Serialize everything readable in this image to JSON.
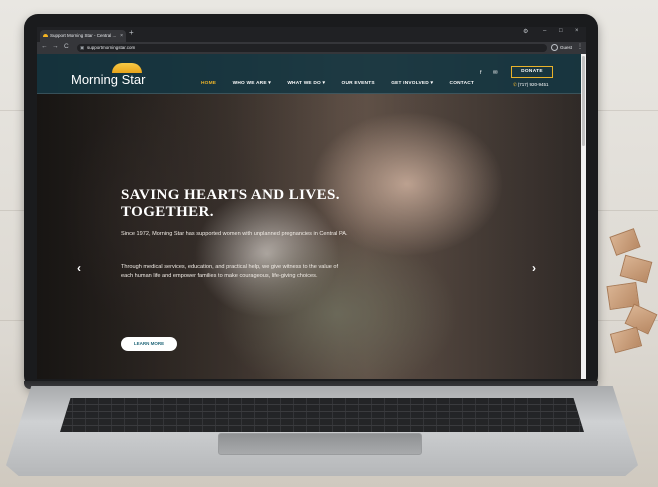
{
  "browser": {
    "tab_title": "Support Morning Star - Central ...",
    "tab_close": "×",
    "new_tab": "+",
    "url": "supportmorningstar.com",
    "profile": "Guest",
    "win_minimize": "–",
    "win_maximize": "□",
    "win_close": "×",
    "back": "←",
    "forward": "→",
    "reload": "C",
    "menu": "⋮"
  },
  "site": {
    "logo_text": "Morning Star",
    "nav": [
      {
        "label": "HOME"
      },
      {
        "label": "WHO WE ARE ▾"
      },
      {
        "label": "WHAT WE DO ▾"
      },
      {
        "label": "OUR EVENTS"
      },
      {
        "label": "GET INVOLVED ▾"
      },
      {
        "label": "CONTACT"
      }
    ],
    "social_facebook": "f",
    "social_email": "✉",
    "donate": "DONATE",
    "phone": "(717) 920-9451",
    "hero": {
      "title": "Saving Hearts and Lives. Together.",
      "paragraph1": "Since 1972, Morning Star has supported women with unplanned pregnancies in Central PA.",
      "paragraph2": "Through medical services, education, and practical help, we give witness to the value of each human life and empower families to make courageous, life-giving choices.",
      "cta": "LEARN MORE",
      "prev": "‹",
      "next": "›"
    }
  },
  "colors": {
    "header_bg": "#14374290",
    "accent_gold": "#e9b22a",
    "cta_text": "#23677a"
  }
}
